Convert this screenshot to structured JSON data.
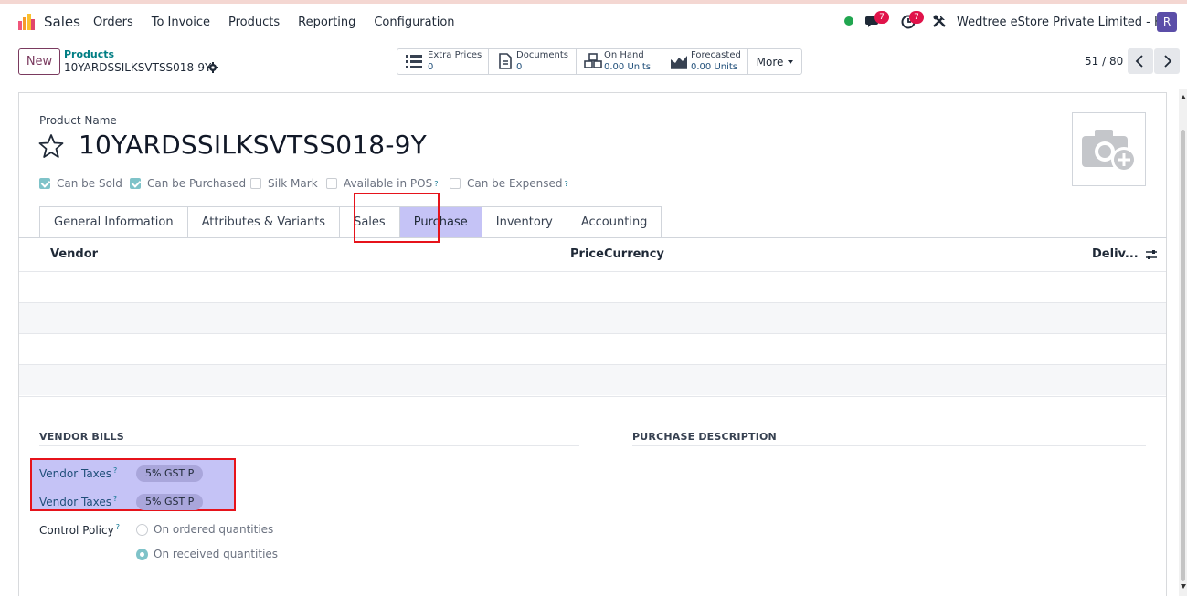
{
  "navbar": {
    "app_name": "Sales",
    "menu": [
      "Orders",
      "To Invoice",
      "Products",
      "Reporting",
      "Configuration"
    ],
    "chat_count": "7",
    "activity_count": "7",
    "company": "Wedtree eStore Private Limited - HO",
    "avatar_letter": "R"
  },
  "control": {
    "new_label": "New",
    "breadcrumb_parent": "Products",
    "breadcrumb_current": "10YARDSSILKSVTSS018-9Y",
    "smart_buttons": [
      {
        "label": "Extra Prices",
        "value": "0",
        "icon": "list-icon"
      },
      {
        "label": "Documents",
        "value": "0",
        "icon": "document-icon"
      },
      {
        "label": "On Hand",
        "value": "0.00 Units",
        "icon": "cubes-icon"
      },
      {
        "label": "Forecasted",
        "value": "0.00 Units",
        "icon": "area-chart-icon"
      }
    ],
    "more_label": "More",
    "pager": "51 / 80"
  },
  "form": {
    "product_name_label": "Product Name",
    "product_name": "10YARDSSILKSVTSS018-9Y",
    "checkboxes": [
      {
        "label": "Can be Sold",
        "checked": true
      },
      {
        "label": "Can be Purchased",
        "checked": true
      },
      {
        "label": "Silk Mark",
        "checked": false
      },
      {
        "label": "Available in POS",
        "checked": false
      },
      {
        "label": "Can be Expensed",
        "checked": false
      }
    ],
    "tabs": [
      "General Information",
      "Attributes & Variants",
      "Sales",
      "Purchase",
      "Inventory",
      "Accounting"
    ],
    "active_tab": "Purchase",
    "help_mark": "?"
  },
  "vendor_table": {
    "columns": [
      "Vendor",
      "Price",
      "Currency",
      "Deliv..."
    ]
  },
  "vendor_bills": {
    "title": "VENDOR BILLS",
    "tax_label": "Vendor Taxes",
    "taxes": [
      "5% GST P",
      "5% GST P"
    ],
    "control_policy_label": "Control Policy",
    "options": [
      {
        "label": "On ordered quantities",
        "selected": false
      },
      {
        "label": "On received quantities",
        "selected": true
      }
    ]
  },
  "purchase_description": {
    "title": "PURCHASE DESCRIPTION"
  },
  "colors": {
    "accent": "#7a3a5f",
    "highlight": "#c5c3f6",
    "annotation": "#e6131b",
    "teal": "#017e84"
  }
}
